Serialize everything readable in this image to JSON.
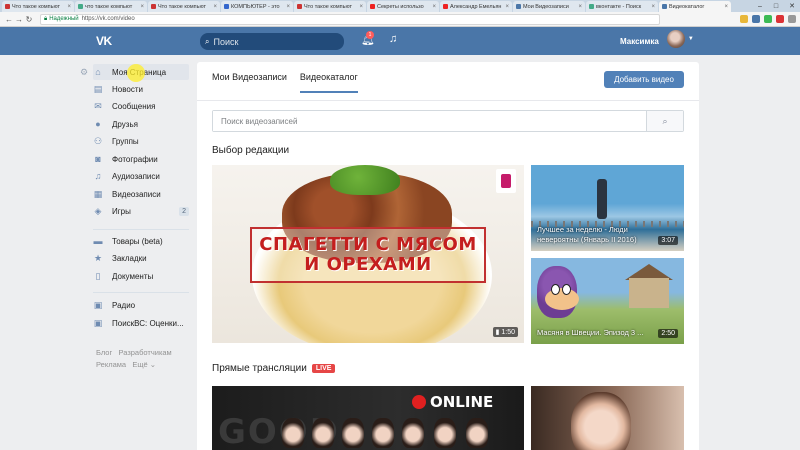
{
  "browser": {
    "tabs": [
      {
        "title": "Что такое компьют",
        "color": "#c33",
        "active": false
      },
      {
        "title": "что такое компьют",
        "color": "#4a8",
        "active": false
      },
      {
        "title": "Что такое компьют",
        "color": "#c33",
        "active": false
      },
      {
        "title": "КОМПЬЮТЕР - это",
        "color": "#36c",
        "active": false
      },
      {
        "title": "Что такое компьют",
        "color": "#c33",
        "active": false
      },
      {
        "title": "Секреты использо",
        "color": "#e22",
        "active": false
      },
      {
        "title": "Александр Емельян",
        "color": "#e22",
        "active": false
      },
      {
        "title": "Мои Видеозаписи",
        "color": "#4a76a8",
        "active": false
      },
      {
        "title": "вконтакте - Поиск",
        "color": "#4a8",
        "active": false
      },
      {
        "title": "Видеокаталог",
        "color": "#4a76a8",
        "active": true
      }
    ],
    "address": {
      "secure_label": "Надежный",
      "url": "https://vk.com/video"
    }
  },
  "header": {
    "logo": "VK",
    "search_placeholder": "Поиск",
    "notifications_count": "1",
    "user_name": "Максимка",
    "colors": {
      "bar": "#4a76a8",
      "search": "#224b7a"
    }
  },
  "sidebar": {
    "items": [
      {
        "label": "Моя Страница",
        "icon": "home-icon",
        "glyph": "⌂"
      },
      {
        "label": "Новости",
        "icon": "news-icon",
        "glyph": "▤"
      },
      {
        "label": "Сообщения",
        "icon": "messages-icon",
        "glyph": "✉"
      },
      {
        "label": "Друзья",
        "icon": "friends-icon",
        "glyph": "●"
      },
      {
        "label": "Группы",
        "icon": "groups-icon",
        "glyph": "⚇"
      },
      {
        "label": "Фотографии",
        "icon": "photos-icon",
        "glyph": "◙"
      },
      {
        "label": "Аудиозаписи",
        "icon": "music-icon",
        "glyph": "♫"
      },
      {
        "label": "Видеозаписи",
        "icon": "video-icon",
        "glyph": "▦"
      },
      {
        "label": "Игры",
        "icon": "games-icon",
        "glyph": "◈",
        "count": "2"
      },
      {
        "label": "Товары (beta)",
        "icon": "market-icon",
        "glyph": "▬"
      },
      {
        "label": "Закладки",
        "icon": "bookmarks-icon",
        "glyph": "★"
      },
      {
        "label": "Документы",
        "icon": "documents-icon",
        "glyph": "▯"
      },
      {
        "label": "Радио",
        "icon": "app-icon",
        "glyph": "▣"
      },
      {
        "label": "ПоискВС: Оценки...",
        "icon": "app-icon",
        "glyph": "▣"
      }
    ],
    "footer": {
      "row1": [
        "Блог",
        "Разработчикам"
      ],
      "row2": [
        "Реклама",
        "Ещё ⌄"
      ]
    }
  },
  "main": {
    "tabs": [
      "Мои Видеозаписи",
      "Видеокаталог"
    ],
    "add_button": "Добавить видео",
    "search_placeholder": "Поиск видеозаписей",
    "editors_title": "Выбор редакции",
    "featured": {
      "banner_line1": "СПАГЕТТИ С МЯСОМ",
      "banner_line2": "И ОРЕХАМИ",
      "duration": "1:50"
    },
    "side_videos": [
      {
        "title": "Лучшее за неделю - Люди невероятны (Январь II 2016)",
        "duration": "3:07"
      },
      {
        "title": "Масяня в Швеции. Эпизод 3 ...",
        "duration": "2:50"
      }
    ],
    "live_title": "Прямые трансляции",
    "live_badge": "LIVE",
    "live_thumb": {
      "overlay": "ONLINE",
      "bg_text": "GOOD"
    }
  }
}
